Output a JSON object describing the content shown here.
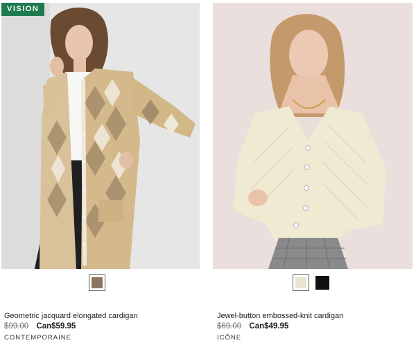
{
  "products": [
    {
      "badge": "VISION",
      "name": "Geometric jacquard elongated cardigan",
      "old_price": "$99.00",
      "new_price": "Can$59.95",
      "brand": "CONTEMPORAINE",
      "swatches": [
        {
          "color": "#8a7560",
          "selected": true
        }
      ]
    },
    {
      "name": "Jewel-button embossed-knit cardigan",
      "old_price": "$69.00",
      "new_price": "Can$49.95",
      "brand": "ICÔNE",
      "swatches": [
        {
          "color": "#e9e4d4",
          "selected": true
        },
        {
          "color": "#111111",
          "selected": false
        }
      ]
    }
  ]
}
